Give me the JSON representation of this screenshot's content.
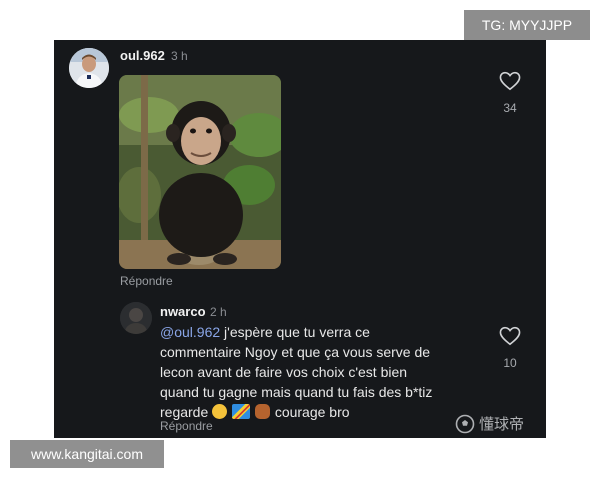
{
  "overlays": {
    "tag_top": "TG: MYYJJPP",
    "tag_bottom": "www.kangitai.com"
  },
  "comment": {
    "username": "oul.962",
    "time": "3 h",
    "reply_label": "Répondre",
    "likes": "34"
  },
  "reply": {
    "username": "nwarco",
    "time": "2 h",
    "mention": "@oul.962",
    "line1": " j'espère que tu verra ce",
    "line2": "commentaire Ngoy et que ça vous serve de",
    "line3": "lecon avant de faire vos choix c'est bien",
    "line4": "quand tu gagne mais quand tu fais des b*tiz",
    "line5_start": "regarde",
    "line5_end": " courage bro",
    "reply_label": "Répondre",
    "likes": "10"
  },
  "watermark": {
    "text": "懂球帝"
  },
  "icons": {
    "heart": "heart-icon",
    "logo": "soccer-ball-icon"
  },
  "colors": {
    "panel": "#16181b",
    "mention": "#8aa6e8"
  }
}
